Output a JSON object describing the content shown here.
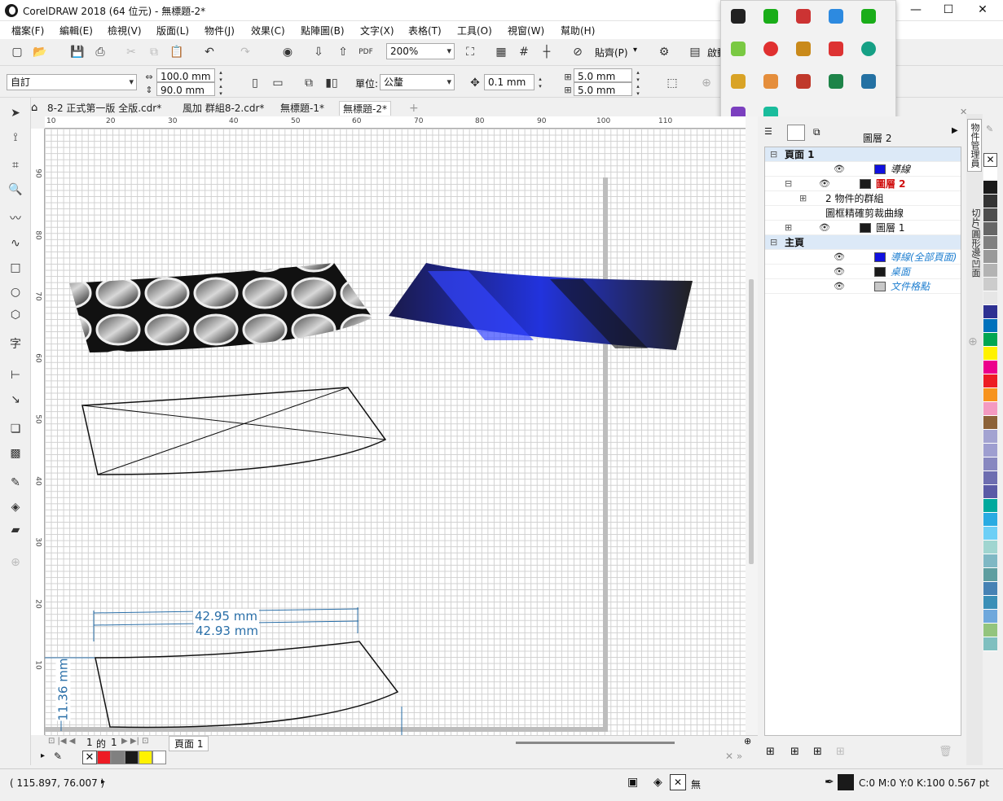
{
  "window": {
    "title": "CorelDRAW 2018 (64 位元) - 無標題-2*",
    "min": "—",
    "max": "☐",
    "close": "✕"
  },
  "menu": [
    "檔案(F)",
    "編輯(E)",
    "檢視(V)",
    "版面(L)",
    "物件(J)",
    "效果(C)",
    "點陣圖(B)",
    "文字(X)",
    "表格(T)",
    "工具(O)",
    "視窗(W)",
    "幫助(H)"
  ],
  "standard_toolbar": {
    "zoom": "200%",
    "snap_label": "貼齊(P)",
    "launch_label": "啟動"
  },
  "property_bar": {
    "page_preset": "自訂",
    "width": "100.0 mm",
    "height": "90.0 mm",
    "units_label": "單位:",
    "units_value": "公釐",
    "nudge": "0.1 mm",
    "dup_x": "5.0 mm",
    "dup_y": "5.0 mm"
  },
  "doc_tabs": [
    "8-2 正式第一版 全版.cdr*",
    "風加 群組8-2.cdr*",
    "無標題-1*",
    "無標題-2*"
  ],
  "ruler_top": [
    "10",
    "20",
    "30",
    "40",
    "50",
    "60",
    "70",
    "80",
    "90",
    "100",
    "110"
  ],
  "ruler_left": [
    "90",
    "80",
    "70",
    "60",
    "50",
    "40",
    "30",
    "20",
    "10"
  ],
  "dimensions": {
    "d1": "42.95 mm",
    "d2": "42.93 mm",
    "d3": "11.36 mm"
  },
  "page_nav": {
    "current": "1",
    "of": "的",
    "total": "1",
    "page_tab": "頁面 1"
  },
  "statusbar": {
    "coords": "( 115.897, 76.007 )",
    "fill": "無",
    "outline": "C:0 M:0 Y:0 K:100  0.567 pt"
  },
  "docker": {
    "header": "圖層 2",
    "tab1": "物件管理員",
    "tab2": "切片/圓形邊/凹面",
    "tree": [
      {
        "label": "頁面 1",
        "style": "bold",
        "indent": 0,
        "expander": "⊟",
        "color": ""
      },
      {
        "label": "導線",
        "style": "italic",
        "indent": 2,
        "expander": "",
        "color": "#1010e0"
      },
      {
        "label": "圖層 2",
        "style": "red",
        "indent": 1,
        "expander": "⊟",
        "color": "#1a1a1a"
      },
      {
        "label": "2 物件的群組",
        "style": "normal",
        "indent": 2,
        "expander": "⊞",
        "color": ""
      },
      {
        "label": "圖框精確剪裁曲線",
        "style": "normal",
        "indent": 2,
        "expander": "",
        "color": ""
      },
      {
        "label": "圖層 1",
        "style": "normal",
        "indent": 1,
        "expander": "⊞",
        "color": "#1a1a1a"
      },
      {
        "label": "主頁",
        "style": "bold",
        "indent": 0,
        "expander": "⊟",
        "color": ""
      },
      {
        "label": "導線(全部頁面)",
        "style": "blueitalic",
        "indent": 2,
        "expander": "",
        "color": "#1010e0"
      },
      {
        "label": "桌面",
        "style": "blueitalic",
        "indent": 2,
        "expander": "",
        "color": "#1a1a1a"
      },
      {
        "label": "文件格點",
        "style": "blueitalic",
        "indent": 2,
        "expander": "",
        "color": "#c8c8c8"
      }
    ]
  },
  "palette_right": [
    "#ffffff",
    "#1a1a1a",
    "#333333",
    "#4d4d4d",
    "#666666",
    "#808080",
    "#999999",
    "#b3b3b3",
    "#cccccc",
    "#e6e6e6",
    "#2e3192",
    "#0071bc",
    "#00a651",
    "#fff200",
    "#ec008c",
    "#ed1c24",
    "#f7931e",
    "#f49ac1",
    "#8c6239",
    "#a3a3d1",
    "#9e9ed0",
    "#8888c0",
    "#6d6db0",
    "#5a5aa6",
    "#00a99d",
    "#29abe2",
    "#6dcff6",
    "#a0d5d0",
    "#7fb8c4",
    "#5f9ea0",
    "#4682b4",
    "#3a8fb7",
    "#6fa8dc",
    "#93c47d",
    "#7fbfbf"
  ],
  "palette_bottom": [
    "#ed1c24",
    "#808080",
    "#1a1a1a",
    "#fff200",
    "#ffffff"
  ]
}
